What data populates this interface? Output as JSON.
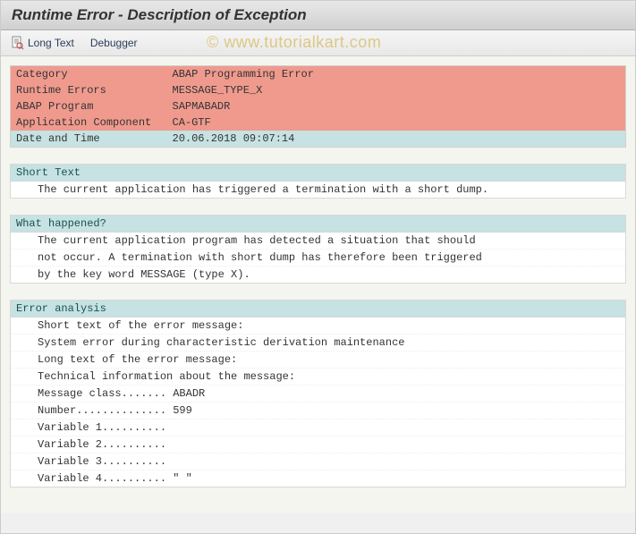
{
  "header": {
    "title": "Runtime Error - Description of Exception"
  },
  "toolbar": {
    "long_text": "Long Text",
    "debugger": "Debugger"
  },
  "watermark": "© www.tutorialkart.com",
  "info": {
    "rows": [
      {
        "label": "Category",
        "value": "ABAP Programming Error",
        "alt": false
      },
      {
        "label": "Runtime Errors",
        "value": "MESSAGE_TYPE_X",
        "alt": false
      },
      {
        "label": "ABAP Program",
        "value": "SAPMABADR",
        "alt": false
      },
      {
        "label": "Application Component",
        "value": "CA-GTF",
        "alt": false
      },
      {
        "label": "Date and Time",
        "value": "20.06.2018 09:07:14",
        "alt": true
      }
    ]
  },
  "sections": {
    "short_text": {
      "header": "Short Text",
      "lines": [
        "The current application has triggered a termination with a short dump."
      ]
    },
    "what_happened": {
      "header": "What happened?",
      "lines": [
        "The current application program has detected a situation that should",
        "not occur. A termination with short dump has therefore been triggered",
        "by the key word MESSAGE (type X)."
      ]
    },
    "error_analysis": {
      "header": "Error analysis",
      "lines": [
        "Short text of the error message:",
        "System error during characteristic derivation maintenance",
        "Long text of the error message:",
        "Technical information about the message:",
        "Message class....... ABADR",
        "Number.............. 599",
        "Variable 1..........",
        "Variable 2..........",
        "Variable 3..........",
        "Variable 4.......... \" \""
      ]
    }
  }
}
